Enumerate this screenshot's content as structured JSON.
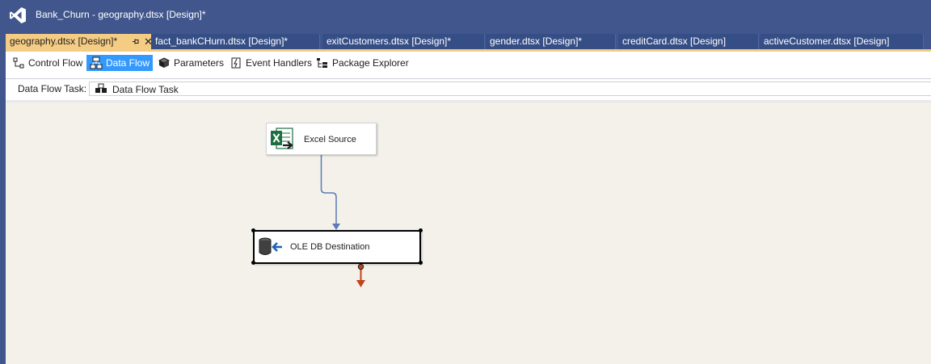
{
  "window": {
    "title": "Bank_Churn - geography.dtsx [Design]*",
    "logo_icon": "visual-studio-logo-icon"
  },
  "tabs": [
    {
      "label": "geography.dtsx [Design]*",
      "active": true
    },
    {
      "label": "fact_bankCHurn.dtsx [Design]*",
      "active": false
    },
    {
      "label": "exitCustomers.dtsx [Design]*",
      "active": false
    },
    {
      "label": "gender.dtsx [Design]*",
      "active": false
    },
    {
      "label": "creditCard.dtsx [Design]",
      "active": false
    },
    {
      "label": "activeCustomer.dtsx [Design]",
      "active": false
    }
  ],
  "active_tab_close": "✕",
  "designer_tabs": [
    {
      "label": "Control Flow",
      "icon": "control-flow-icon",
      "active": false
    },
    {
      "label": "Data Flow",
      "icon": "data-flow-icon",
      "active": true
    },
    {
      "label": "Parameters",
      "icon": "parameters-icon",
      "active": false
    },
    {
      "label": "Event Handlers",
      "icon": "event-handlers-icon",
      "active": false
    },
    {
      "label": "Package Explorer",
      "icon": "package-explorer-icon",
      "active": false
    }
  ],
  "task_selector": {
    "label": "Data Flow Task:",
    "value": "Data Flow Task",
    "icon": "data-flow-task-icon"
  },
  "canvas": {
    "components": [
      {
        "label": "Excel Source",
        "icon": "excel-source-icon"
      },
      {
        "label": "OLE DB Destination",
        "icon": "ole-db-destination-icon",
        "selected": true
      }
    ],
    "colors": {
      "data_path": "#5b7ab8",
      "error_path": "#c0451d",
      "canvas_bg": "#f3f1ea",
      "accent": "#3399ff",
      "active_tab": "#f5cc84",
      "title_bar": "#40568d"
    }
  }
}
